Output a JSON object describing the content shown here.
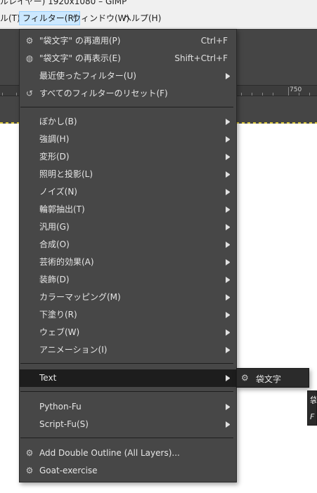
{
  "window": {
    "title": "ルレイヤー) 1920x1080 – GIMP"
  },
  "menubar": {
    "items": [
      "ル(T)",
      "フィルター(R)",
      "ウィンドウ(W)",
      "ヘルプ(H)"
    ]
  },
  "ruler": {
    "label": "750"
  },
  "filters_menu": {
    "items": [
      {
        "icon": "gear-icon",
        "label": "\"袋文字\" の再適用(P)",
        "shortcut": "Ctrl+F"
      },
      {
        "icon": "refresh-dialog-icon",
        "label": "\"袋文字\" の再表示(E)",
        "shortcut": "Shift+Ctrl+F"
      },
      {
        "label": "最近使ったフィルター(U)",
        "submenu": true
      },
      {
        "icon": "reset-icon",
        "label": "すべてのフィルターのリセット(F)"
      },
      {
        "label": "ぼかし(B)",
        "submenu": true
      },
      {
        "label": "強調(H)",
        "submenu": true
      },
      {
        "label": "変形(D)",
        "submenu": true
      },
      {
        "label": "照明と投影(L)",
        "submenu": true
      },
      {
        "label": "ノイズ(N)",
        "submenu": true
      },
      {
        "label": "輪郭抽出(T)",
        "submenu": true
      },
      {
        "label": "汎用(G)",
        "submenu": true
      },
      {
        "label": "合成(O)",
        "submenu": true
      },
      {
        "label": "芸術的効果(A)",
        "submenu": true
      },
      {
        "label": "装飾(D)",
        "submenu": true
      },
      {
        "label": "カラーマッピング(M)",
        "submenu": true
      },
      {
        "label": "下塗り(R)",
        "submenu": true
      },
      {
        "label": "ウェブ(W)",
        "submenu": true
      },
      {
        "label": "アニメーション(I)",
        "submenu": true
      },
      {
        "label": "Text",
        "submenu": true,
        "highlighted": true
      },
      {
        "label": "Python-Fu",
        "submenu": true
      },
      {
        "label": "Script-Fu(S)",
        "submenu": true
      },
      {
        "icon": "gear-icon",
        "label": "Add Double Outline (All Layers)..."
      },
      {
        "icon": "gear-icon",
        "label": "Goat-exercise"
      }
    ]
  },
  "text_submenu": {
    "items": [
      {
        "icon": "gear-icon",
        "label": "袋文字"
      }
    ]
  },
  "tooltip": {
    "line1": "袋",
    "line2": "F"
  },
  "colors": {
    "menu_bg": "#474747",
    "highlight_bg": "#1d1d1d",
    "menubar_bg": "#f0f0f0",
    "active_menu": "#cce8ff",
    "guide": "#d8c53a"
  }
}
